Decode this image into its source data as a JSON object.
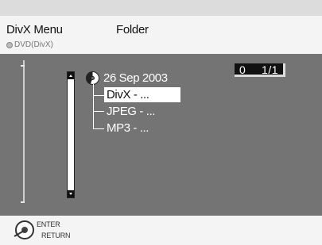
{
  "header": {
    "menu_title": "DivX Menu",
    "disc_source": "DVD(DivX)",
    "folder_title": "Folder"
  },
  "tree": {
    "root_label": "26 Sep 2003",
    "items": [
      {
        "label": "DivX - ...",
        "selected": true
      },
      {
        "label": "JPEG - ...",
        "selected": false
      },
      {
        "label": "MP3  - ...",
        "selected": false
      }
    ]
  },
  "counter": {
    "selected": "0",
    "page": "1/1"
  },
  "footer": {
    "enter_label": "ENTER",
    "return_label": "RETURN"
  },
  "icons": {
    "disc": "disc-icon",
    "remote": "remote-control-icon"
  }
}
